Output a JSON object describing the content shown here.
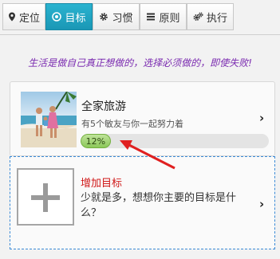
{
  "tabs": [
    {
      "label": "定位",
      "icon": "map-pin-icon",
      "active": false
    },
    {
      "label": "目标",
      "icon": "target-icon",
      "active": true
    },
    {
      "label": "习惯",
      "icon": "gear-icon",
      "active": false
    },
    {
      "label": "原则",
      "icon": "list-icon",
      "active": false
    },
    {
      "label": "执行",
      "icon": "gears-icon",
      "active": false
    }
  ],
  "motto": "生活是做自己真正想做的，选择必须做的，即使失败!",
  "goal": {
    "title": "全家旅游",
    "subtitle": "有5个敏友与你一起努力着",
    "progress_label": "12%",
    "progress_value": 0.12,
    "chevron": "›"
  },
  "add_goal": {
    "title": "增加目标",
    "description": "少就是多，想想你主要的目标是什么？",
    "chevron": "›"
  },
  "colors": {
    "accent": "#1fa6c4",
    "motto": "#7a2ab0",
    "add_title": "#d01818",
    "annotation_arrow": "#e02020"
  }
}
